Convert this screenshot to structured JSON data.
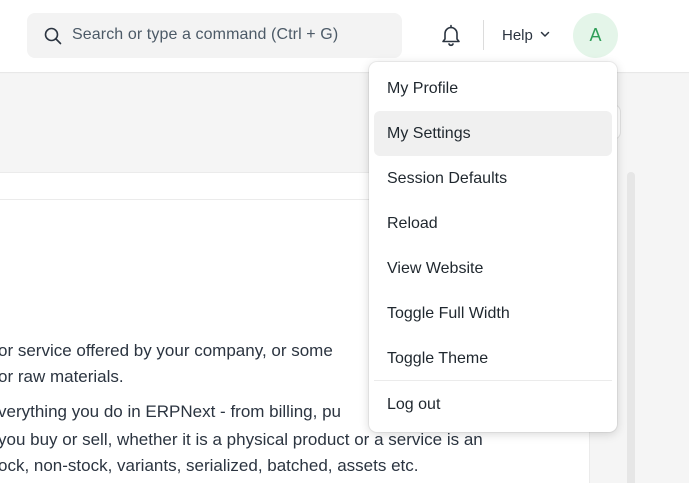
{
  "navbar": {
    "search_placeholder": "Search or type a command (Ctrl + G)",
    "help_label": "Help",
    "avatar_initial": "A"
  },
  "background": {
    "lines": [
      "or service offered by your company, or some",
      "or raw materials.",
      "verything you do in ERPNext - from billing, pu",
      "you buy or sell, whether it is a physical product or a service is an",
      "ock, non-stock, variants, serialized, batched, assets etc."
    ]
  },
  "user_menu": {
    "items": [
      {
        "label": "My Profile"
      },
      {
        "label": "My Settings",
        "active": true
      },
      {
        "label": "Session Defaults"
      },
      {
        "label": "Reload"
      },
      {
        "label": "View Website"
      },
      {
        "label": "Toggle Full Width"
      },
      {
        "label": "Toggle Theme"
      },
      {
        "label": "Log out"
      }
    ]
  },
  "colors": {
    "avatar_bg": "#e4f5e9",
    "avatar_text": "#2f9e58",
    "active_item_bg": "#f0f0f0"
  }
}
